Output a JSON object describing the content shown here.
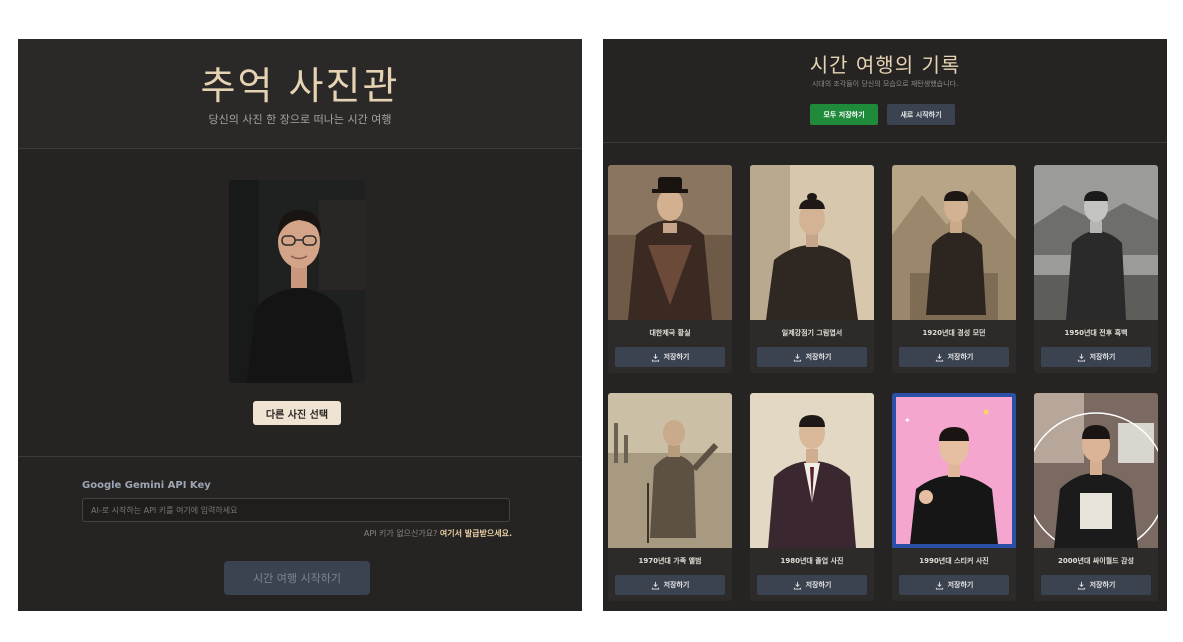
{
  "left_panel": {
    "title": "추억 사진관",
    "subtitle": "당신의 사진 한 장으로 떠나는 시간 여행",
    "change_photo_label": "다른 사진 선택",
    "api_key": {
      "label": "Google Gemini API Key",
      "placeholder": "AI-로 시작하는 API 키를 여기에 입력하세요",
      "value": "",
      "help_text": "API 키가 없으신가요?",
      "help_link": "여기서 발급받으세요."
    },
    "start_label": "시간 여행 시작하기"
  },
  "right_panel": {
    "title": "시간 여행의 기록",
    "subtitle": "시대의 조각들이 당신의 모습으로 재탄생했습니다.",
    "save_all_label": "모두 저장하기",
    "restart_label": "새로 시작하기",
    "save_label": "저장하기",
    "cards": [
      {
        "caption": "대한제국 황실"
      },
      {
        "caption": "일제강점기 그림엽서"
      },
      {
        "caption": "1920년대 경성 모던"
      },
      {
        "caption": "1950년대 전후 흑백"
      },
      {
        "caption": "1970년대 가족 앨범"
      },
      {
        "caption": "1980년대 졸업 사진"
      },
      {
        "caption": "1990년대 스티커 사진"
      },
      {
        "caption": "2000년대 싸이월드 감성"
      }
    ]
  },
  "colors": {
    "panel_bg": "#262423",
    "accent_title": "#e6d3b3",
    "save_all_green": "#1f8a3a",
    "button_slate": "#3b4250"
  },
  "icons": [
    "download-icon"
  ]
}
